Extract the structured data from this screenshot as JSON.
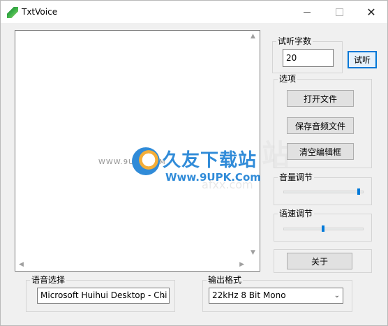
{
  "window": {
    "title": "TxtVoice"
  },
  "titlebar_buttons": {
    "minimize": "",
    "maximize": "",
    "close": "✕"
  },
  "preview": {
    "group_label": "试听字数",
    "count_value": "20",
    "button_label": "试听"
  },
  "options": {
    "group_label": "选项",
    "open_file": "打开文件",
    "save_audio": "保存音频文件",
    "clear_editor": "清空编辑框"
  },
  "volume": {
    "group_label": "音量调节",
    "level": 0.97
  },
  "speed": {
    "group_label": "语速调节",
    "level": 0.5
  },
  "about": {
    "button_label": "关于"
  },
  "voice_select": {
    "group_label": "语音选择",
    "selected": "Microsoft Huihui Desktop - Chi"
  },
  "output_format": {
    "group_label": "输出格式",
    "selected": "22kHz 8 Bit Mono"
  },
  "watermark": {
    "title": "久友下载站",
    "url": "Www.9UPK.Com",
    "left_text": "WWW.9UPK.COM",
    "ghost_text": "站",
    "ghost_url": "afxx.com"
  }
}
